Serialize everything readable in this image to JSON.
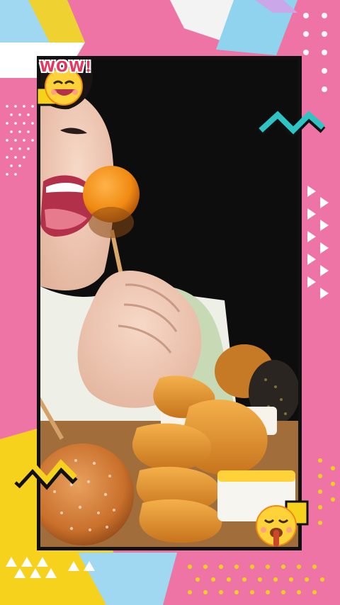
{
  "sticker": {
    "wow_text": "WOW!"
  },
  "colors": {
    "background_pink": "#ef74a6",
    "frame_black": "#111111",
    "accent_teal": "#2ec4c6",
    "accent_yellow": "#f7d21c",
    "accent_light_blue": "#9fd8f0"
  },
  "icons": [
    "wow-emoji-icon",
    "yummy-emoji-icon",
    "zigzag-icon",
    "triangle-pattern-icon",
    "dot-pattern-icon"
  ]
}
